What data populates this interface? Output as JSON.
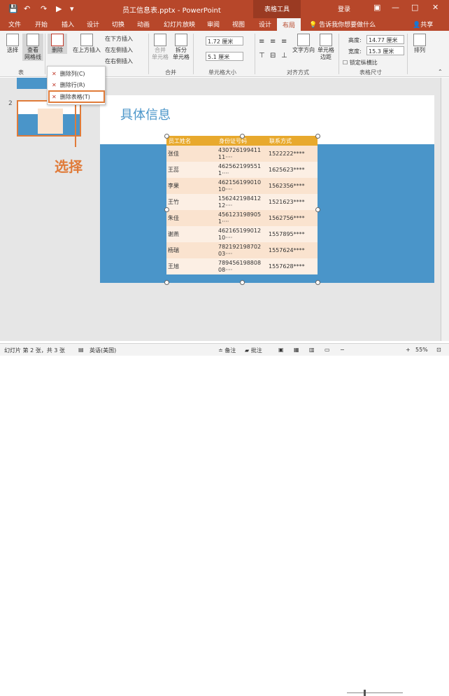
{
  "titlebar": {
    "doc_title": "员工信息表.pptx - PowerPoint",
    "context_tools": "表格工具",
    "login": "登录",
    "save_icon": "save-icon",
    "colors": {
      "brand": "#b7472a",
      "accent": "#e07b39"
    }
  },
  "tabs": [
    "文件",
    "开始",
    "插入",
    "设计",
    "切换",
    "动画",
    "幻灯片放映",
    "审阅",
    "视图",
    "设计",
    "布局"
  ],
  "help": "告诉我你想要做什么",
  "share": "共享",
  "ribbon": {
    "select": "选择",
    "gridlines": "查看\n网格线",
    "delete": "删除",
    "insert_above": "在上方插入",
    "insert_below": "在下方插入",
    "insert_left": "在左侧插入",
    "insert_right": "在右侧插入",
    "merge_cells": "合并\n单元格",
    "split_cells": "拆分\n单元格",
    "height_value": "1.72 厘米",
    "width_value": "5.1 厘米",
    "text_direction": "文字方向",
    "cell_margins": "单元格\n边距",
    "table_height_label": "高度:",
    "table_height_value": "14.77 厘米",
    "table_width_label": "宽度:",
    "table_width_value": "15.3 厘米",
    "lock_ratio": "锁定纵横比",
    "arrange": "排列",
    "groups": {
      "table": "表",
      "merge": "合并",
      "cell_size": "单元格大小",
      "alignment": "对齐方式",
      "table_size": "表格尺寸"
    }
  },
  "dropdown": [
    "删除列(C)",
    "删除行(R)",
    "删除表格(T)"
  ],
  "left_pane": {
    "slide_number": "2",
    "callout": "选择"
  },
  "slide": {
    "title": "具体信息",
    "headers": [
      "员工姓名",
      "身份证号码",
      "联系方式"
    ],
    "rows": [
      [
        "张佳",
        "430726199411\n11····",
        "1522222****"
      ],
      [
        "王蕊",
        "462562199551\n1····",
        "1625623****"
      ],
      [
        "李果",
        "462156199010\n10····",
        "1562356****"
      ],
      [
        "王竹",
        "156242198412\n12····",
        "1521623****"
      ],
      [
        "朱佳",
        "456123198905\n1····",
        "1562756****"
      ],
      [
        "谢燕",
        "462165199012\n10····",
        "1557895****"
      ],
      [
        "杨瑞",
        "782192198702\n03····",
        "1557624****"
      ],
      [
        "王旭",
        "789456198808\n08····",
        "1557628****"
      ]
    ]
  },
  "status": {
    "slide_info": "幻灯片 第 2 张，共 3 张",
    "language": "英语(美国)",
    "notes": "备注",
    "comments": "批注",
    "zoom": "55%"
  }
}
